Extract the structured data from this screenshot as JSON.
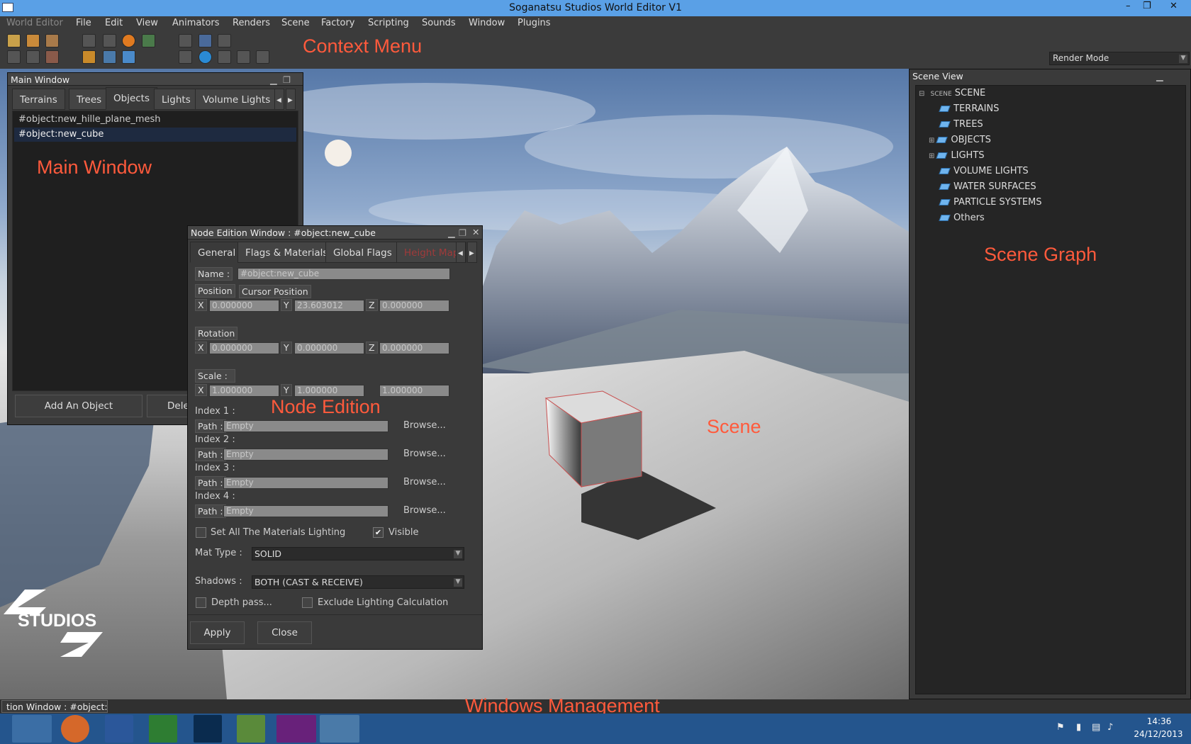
{
  "window": {
    "title": "Soganatsu Studios World Editor V1",
    "minimize": "–",
    "restore": "❐",
    "close": "✕"
  },
  "menu": [
    "World Editor",
    "File",
    "Edit",
    "View",
    "Animators",
    "Renders",
    "Scene",
    "Factory",
    "Scripting",
    "Sounds",
    "Window",
    "Plugins"
  ],
  "toolbar": {
    "render_mode": "Render Mode"
  },
  "annotations": {
    "context_menu": "Context Menu",
    "main_window": "Main Window",
    "node_edition": "Node Edition",
    "scene": "Scene",
    "scene_graph": "Scene Graph",
    "windows_management": "Windows Management"
  },
  "main_window": {
    "title": "Main Window",
    "tabs": [
      "Terrains",
      "Trees",
      "Objects",
      "Lights",
      "Volume Lights"
    ],
    "active_tab": "Objects",
    "items": [
      "#object:new_hille_plane_mesh",
      "#object:new_cube"
    ],
    "add_button": "Add An Object",
    "delete_button": "Dele"
  },
  "node_window": {
    "title": "Node Edition Window : #object:new_cube",
    "tabs": [
      "General",
      "Flags & Materials",
      "Global Flags",
      "Height Map"
    ],
    "name_label": "Name :",
    "name_value": "#object:new_cube",
    "position_label": "Position",
    "cursor_position": "Cursor Position",
    "position": {
      "x": "0.000000",
      "y": "23.603012",
      "z": "0.000000"
    },
    "rotation_label": "Rotation",
    "rotation": {
      "x": "0.000000",
      "y": "0.000000",
      "z": "0.000000"
    },
    "scale_label": "Scale :",
    "scale": {
      "x": "1.000000",
      "y": "1.000000",
      "z": "1.000000"
    },
    "x": "X",
    "y": "Y",
    "z": "Z",
    "indices": [
      {
        "label": "Index 1 :",
        "path": "Empty"
      },
      {
        "label": "Index 2 :",
        "path": "Empty"
      },
      {
        "label": "Index 3 :",
        "path": "Empty"
      },
      {
        "label": "Index 4 :",
        "path": "Empty"
      }
    ],
    "path_label": "Path :",
    "browse": "Browse...",
    "set_all_lighting": "Set All The Materials Lighting",
    "visible": "Visible",
    "mat_type_label": "Mat Type :",
    "mat_type": "SOLID",
    "shadows_label": "Shadows :",
    "shadows": "BOTH (CAST & RECEIVE)",
    "depth_pass": "Depth pass...",
    "exclude_lighting": "Exclude Lighting Calculation",
    "apply": "Apply",
    "close": "Close"
  },
  "scene_view": {
    "title": "Scene View",
    "root_tag": "SCENE",
    "root": "SCENE",
    "items": [
      "TERRAINS",
      "TREES",
      "OBJECTS",
      "LIGHTS",
      "VOLUME LIGHTS",
      "WATER SURFACES",
      "PARTICLE SYSTEMS",
      "Others"
    ]
  },
  "logo": {
    "text": "STUDIOS"
  },
  "status": {
    "text": "tion Window : #object:n"
  },
  "taskbar": {
    "time": "14:36",
    "date": "24/12/2013"
  }
}
